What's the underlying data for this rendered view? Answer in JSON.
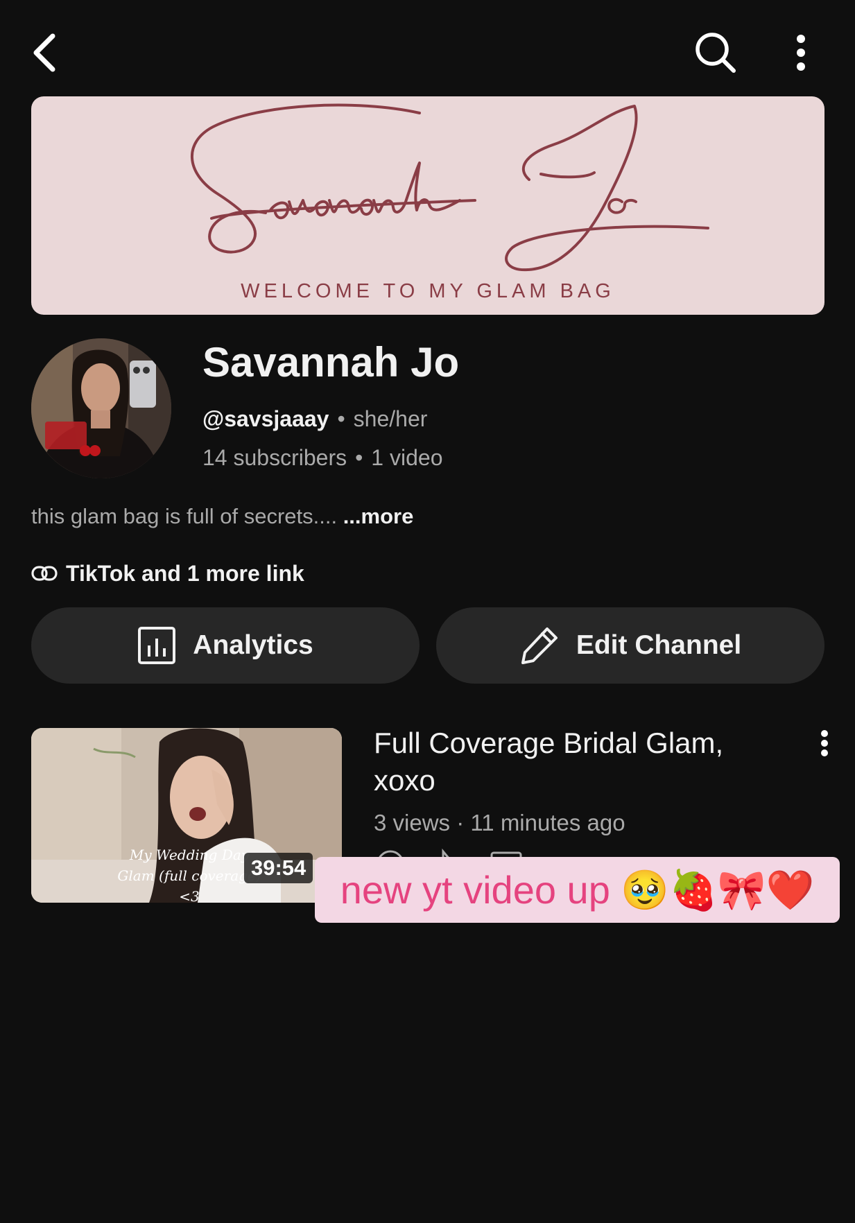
{
  "topbar": {
    "back_icon": "chevron-left-icon",
    "search_icon": "search-icon",
    "more_icon": "more-vertical-icon"
  },
  "banner": {
    "tagline": "WELCOME TO MY GLAM BAG",
    "logo_text": "Savannah Jo",
    "background_color": "#ead7d8",
    "accent_color": "#8a3d46"
  },
  "channel": {
    "name": "Savannah Jo",
    "handle": "@savsjaaay",
    "pronouns": "she/her",
    "subscribers": "14 subscribers",
    "video_count": "1 video",
    "description": "this glam bag is full of secrets.... ",
    "more_label": "...more",
    "links_label": "TikTok and 1 more link"
  },
  "buttons": {
    "analytics_label": "Analytics",
    "edit_label": "Edit Channel"
  },
  "video": {
    "title": "Full Coverage Bridal Glam, xoxo",
    "views": "3 views",
    "separator": "·",
    "age": "11 minutes ago",
    "duration": "39:54",
    "thumbnail_overlay_text": "My Wedding Day Glam (full coverage) <3"
  },
  "caption": {
    "text": "new yt video up 🥹🍓🎀❤️",
    "background_color": "#f3d7e4",
    "text_color": "#e5437f"
  },
  "separators": {
    "dot": "•"
  }
}
